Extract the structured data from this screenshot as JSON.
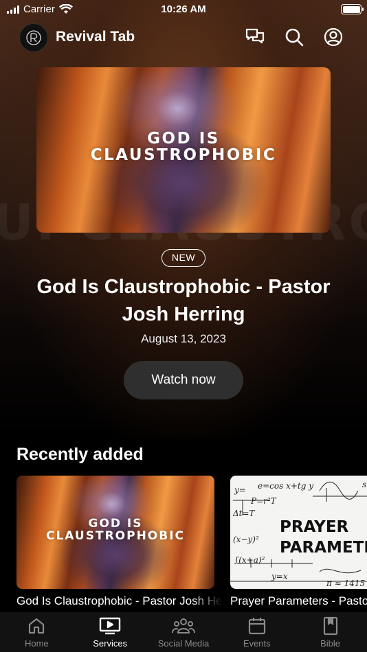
{
  "status_bar": {
    "carrier": "Carrier",
    "time": "10:26 AM",
    "battery_percent": 100
  },
  "header": {
    "app_title": "Revival Tab",
    "icons": [
      "chat-icon",
      "search-icon",
      "profile-icon"
    ]
  },
  "background": {
    "watermark_text": "UI CLAUSTROPHOBIC"
  },
  "featured": {
    "image_text_line1": "GOD IS",
    "image_text_line2": "CLAUSTROPHOBIC",
    "badge": "NEW",
    "title": "God Is Claustrophobic - Pastor Josh Herring",
    "date": "August 13, 2023",
    "watch_button": "Watch now"
  },
  "recently_added": {
    "heading": "Recently added",
    "items": [
      {
        "image_text_line1": "GOD IS",
        "image_text_line2": "CLAUSTROPHOBIC",
        "caption": "God Is Claustrophobic - Pastor Josh Herring"
      },
      {
        "image_text_line1": "PRAYER",
        "image_text_line2": "PARAMETERS",
        "caption": "Prayer Parameters - Pastor Josh Herring"
      }
    ]
  },
  "tab_bar": {
    "tabs": [
      {
        "label": "Home",
        "icon": "home-icon",
        "active": false
      },
      {
        "label": "Services",
        "icon": "tv-icon",
        "active": true
      },
      {
        "label": "Social Media",
        "icon": "people-icon",
        "active": false
      },
      {
        "label": "Events",
        "icon": "calendar-icon",
        "active": false
      },
      {
        "label": "Bible",
        "icon": "bible-icon",
        "active": false
      }
    ]
  },
  "colors": {
    "background": "#000000",
    "tab_bar": "#121212",
    "button": "#2f2f2f",
    "inactive_tab": "#8a8a8a"
  }
}
